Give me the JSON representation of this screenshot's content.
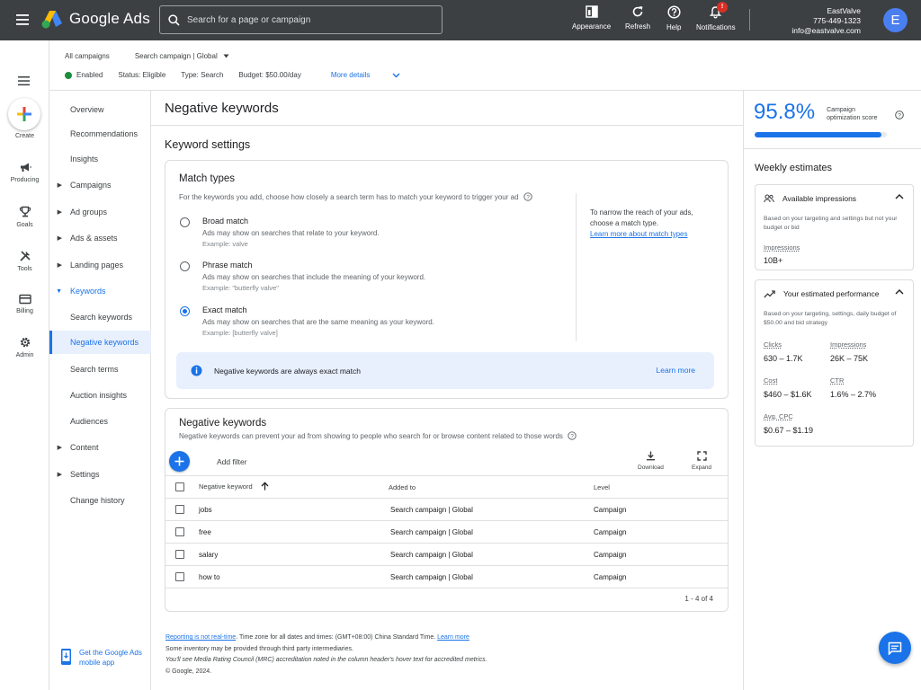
{
  "topbar": {
    "app_name": "Google Ads",
    "search_placeholder": "Search for a page or campaign",
    "actions": {
      "appearance": "Appearance",
      "refresh": "Refresh",
      "help": "Help",
      "notifications": "Notifications",
      "notification_count": "!"
    },
    "account": {
      "name": "EastValve",
      "phone": "775-449-1323",
      "email": "info@eastvalve.com",
      "avatar_letter": "E"
    }
  },
  "rail": {
    "create": "Create",
    "items": [
      "Producing",
      "Goals",
      "Tools",
      "Billing",
      "Admin"
    ]
  },
  "header": {
    "breadcrumb_all": "All campaigns",
    "breadcrumb_campaign": "Search campaign | Global",
    "status_enabled": "Enabled",
    "status": "Status: Eligible",
    "type": "Type: Search",
    "budget": "Budget: $50.00/day",
    "more_details": "More details"
  },
  "pagenav": {
    "items": [
      {
        "label": "Overview"
      },
      {
        "label": "Recommendations"
      },
      {
        "label": "Insights"
      },
      {
        "label": "Campaigns"
      },
      {
        "label": "Ad groups"
      },
      {
        "label": "Ads & assets"
      },
      {
        "label": "Landing pages"
      },
      {
        "label": "Keywords"
      },
      {
        "label": "Search keywords"
      },
      {
        "label": "Negative keywords"
      },
      {
        "label": "Search terms"
      },
      {
        "label": "Auction insights"
      },
      {
        "label": "Audiences"
      },
      {
        "label": "Content"
      },
      {
        "label": "Settings"
      },
      {
        "label": "Change history"
      }
    ],
    "get_app": "Get the Google Ads mobile app"
  },
  "main": {
    "title": "Negative keywords",
    "section_title": "Keyword settings",
    "match_types": {
      "title": "Match types",
      "description": "For the keywords you add, choose how closely a search term has to match your keyword to trigger your ad",
      "options": [
        {
          "title": "Broad match",
          "desc": "Ads may show on searches that relate to your keyword.",
          "example": "Example: valve",
          "checked": false
        },
        {
          "title": "Phrase match",
          "desc": "Ads may show on searches that include the meaning of your keyword.",
          "example": "Example: \"butterfly valve\"",
          "checked": false
        },
        {
          "title": "Exact match",
          "desc": "Ads may show on searches that are the same meaning as your keyword.",
          "example": "Example: [butterfly valve]",
          "checked": true
        }
      ],
      "side_text": "To narrow the reach of your ads, choose a match type.",
      "side_link": "Learn more about match types",
      "banner_text": "Negative keywords are always exact match",
      "banner_link": "Learn more"
    },
    "negative_keywords": {
      "title": "Negative keywords",
      "description": "Negative keywords can prevent your ad from showing to people who search for or browse content related to those words",
      "add_filter": "Add filter",
      "download": "Download",
      "expand": "Expand",
      "columns": [
        "Negative keyword",
        "Added to",
        "Level"
      ],
      "rows": [
        {
          "keyword": "jobs",
          "added_to": "Search campaign | Global",
          "level": "Campaign"
        },
        {
          "keyword": "free",
          "added_to": "Search campaign | Global",
          "level": "Campaign"
        },
        {
          "keyword": "salary",
          "added_to": "Search campaign | Global",
          "level": "Campaign"
        },
        {
          "keyword": "how to",
          "added_to": "Search campaign | Global",
          "level": "Campaign"
        }
      ],
      "pager": "1 - 4 of 4"
    },
    "footer": {
      "reporting_link": "Reporting is not real-time",
      "timezone": ". Time zone for all dates and times: (GMT+08:00) China Standard Time.",
      "learn_more": "Learn more",
      "line2": "Some inventory may be provided through third party intermediaries.",
      "line3": "You'll see Media Rating Council (MRC) accreditation noted in the column header's hover text for accredited metrics.",
      "line4": "© Google, 2024."
    }
  },
  "right": {
    "score": "95.8%",
    "score_fraction": 0.958,
    "score_label": "Campaign optimization score",
    "weekly_title": "Weekly estimates",
    "impressions_card": {
      "title": "Available impressions",
      "note": "Based on your targeting and settings but not your budget or bid",
      "label": "Impressions",
      "value": "10B+"
    },
    "performance_card": {
      "title": "Your estimated performance",
      "note": "Based on your targeting, settings, daily budget of $50.00 and bid strategy",
      "metrics": [
        {
          "label": "Clicks",
          "value": "630 – 1.7K"
        },
        {
          "label": "Impressions",
          "value": "26K – 75K"
        },
        {
          "label": "Cost",
          "value": "$460 – $1.6K"
        },
        {
          "label": "CTR",
          "value": "1.6% – 2.7%"
        },
        {
          "label": "Avg. CPC",
          "value": "$0.67 – $1.19"
        }
      ]
    }
  },
  "colors": {
    "topbar": "#3c4043",
    "accent": "#1a73e8",
    "enabled": "#1e8e3e",
    "badge": "#d93025"
  }
}
